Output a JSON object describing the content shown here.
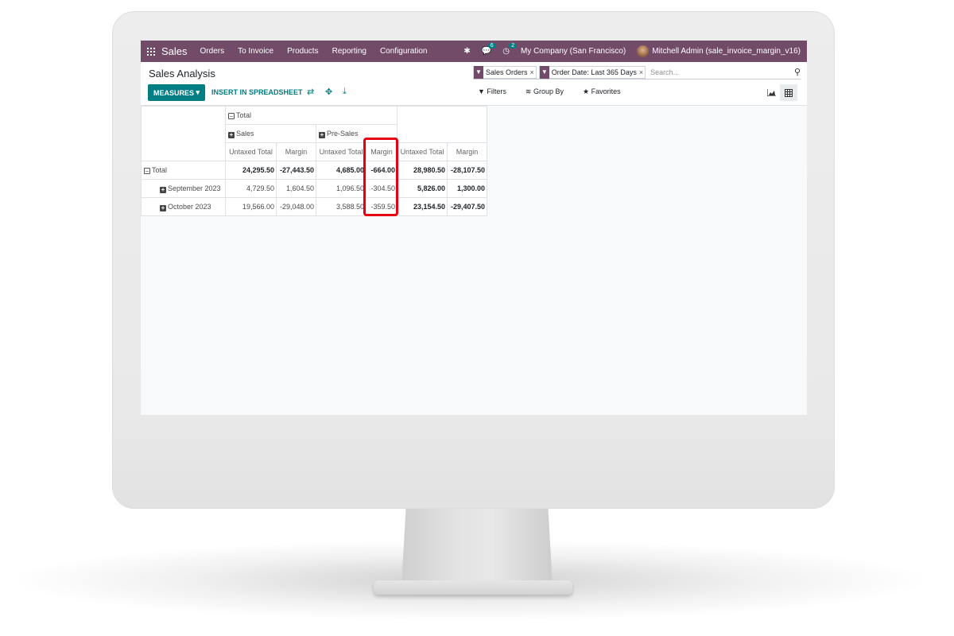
{
  "navbar": {
    "app_name": "Sales",
    "menu": [
      "Orders",
      "To Invoice",
      "Products",
      "Reporting",
      "Configuration"
    ],
    "messages_count": "6",
    "activities_count": "2",
    "company": "My Company (San Francisco)",
    "user": "Mitchell Admin (sale_invoice_margin_v16)"
  },
  "control_panel": {
    "title": "Sales Analysis",
    "measures_label": "MEASURES",
    "insert_label": "INSERT IN SPREADSHEET",
    "facets": [
      "Sales Orders",
      "Order Date: Last 365 Days"
    ],
    "search_placeholder": "Search...",
    "filters_label": "Filters",
    "groupby_label": "Group By",
    "favorites_label": "Favorites"
  },
  "pivot": {
    "col_total_label": "Total",
    "col_groups": [
      "Sales",
      "Pre-Sales"
    ],
    "measure_headers": [
      "Untaxed Total",
      "Margin",
      "Untaxed Total",
      "Margin",
      "Untaxed Total",
      "Margin"
    ],
    "rows": [
      {
        "label": "Total",
        "cells": [
          "24,295.50",
          "-27,443.50",
          "4,685.00",
          "-664.00",
          "28,980.50",
          "-28,107.50"
        ]
      },
      {
        "label": "September 2023",
        "cells": [
          "4,729.50",
          "1,604.50",
          "1,096.50",
          "-304.50",
          "5,826.00",
          "1,300.00"
        ]
      },
      {
        "label": "October 2023",
        "cells": [
          "19,566.00",
          "-29,048.00",
          "3,588.50",
          "-359.50",
          "23,154.50",
          "-29,407.50"
        ]
      }
    ]
  },
  "colors": {
    "navbar": "#714b67",
    "accent": "#017e84",
    "highlight": "#e60012"
  }
}
